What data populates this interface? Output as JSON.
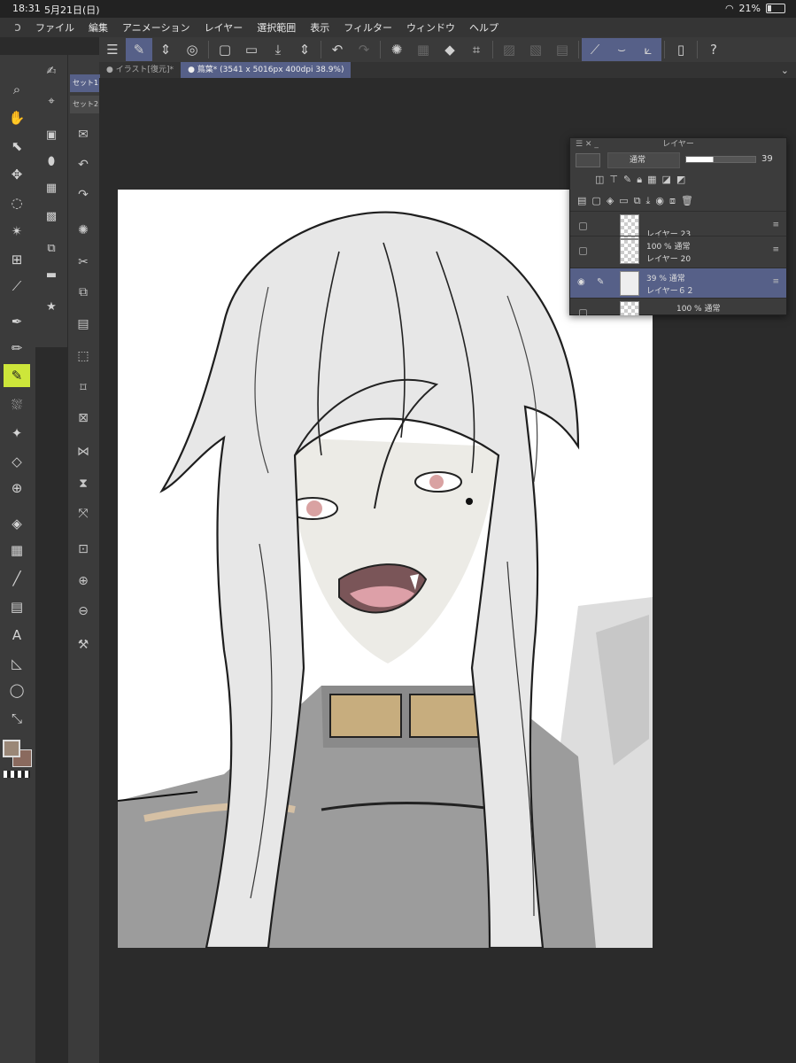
{
  "status": {
    "time": "18:31",
    "date": "5月21日(日)",
    "battery": "21%"
  },
  "menu": [
    "ファイル",
    "編集",
    "アニメーション",
    "レイヤー",
    "選択範囲",
    "表示",
    "フィルター",
    "ウィンドウ",
    "ヘルプ"
  ],
  "tabs": [
    {
      "label": "イラスト[復元]*"
    },
    {
      "label": "蔦葉* (3541 x 5016px 400dpi 38.9%)"
    }
  ],
  "set_panel": {
    "set1": "セット1",
    "set2": "セット2"
  },
  "layer_panel": {
    "title": "レイヤー",
    "blend_mode": "通常",
    "opacity_value": "39",
    "opacity_fraction": 0.39,
    "layers": [
      {
        "line1": "",
        "line2": "レイヤー 23"
      },
      {
        "line1": "100 % 通常",
        "line2": "レイヤー 20"
      },
      {
        "line1": "39 % 通常",
        "line2": "レイヤー６２"
      },
      {
        "line1": "100 % 通常",
        "line2": ""
      }
    ]
  },
  "colors": {
    "accent": "#566088",
    "tool_selected": "#cde63a",
    "main_color": "#9a8777",
    "sub_color": "#8a6a5e"
  }
}
